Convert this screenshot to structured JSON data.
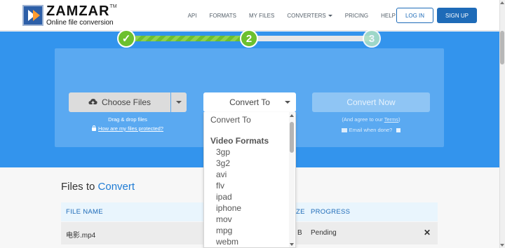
{
  "header": {
    "brand": "ZAMZAR",
    "brand_tm": "TM",
    "tagline": "Online file conversion",
    "nav": [
      "API",
      "FORMATS",
      "MY FILES",
      "CONVERTERS",
      "PRICING",
      "HELP"
    ],
    "login_label": "LOG IN",
    "signup_label": "SIGN UP"
  },
  "steps": {
    "step1_symbol": "✓",
    "step2_label": "2",
    "step3_label": "3",
    "progress_fraction": 0.5
  },
  "choose": {
    "button_label": "Choose Files",
    "drag_text": "Drag & drop files",
    "protect_link": "How are my files protected?"
  },
  "convert": {
    "select_value": "Convert To",
    "now_label": "Convert Now",
    "agree_prefix": "(And agree to our ",
    "agree_terms": "Terms",
    "agree_suffix": ")",
    "email_label": "Email when done?"
  },
  "dropdown": {
    "header": "Convert To",
    "group_label": "Video Formats",
    "options": [
      "3gp",
      "3g2",
      "avi",
      "flv",
      "ipad",
      "iphone",
      "mov",
      "mpg",
      "webm"
    ]
  },
  "files": {
    "title_prefix": "Files to ",
    "title_highlight": "Convert",
    "columns": {
      "name": "FILE NAME",
      "size_partial": "ZE",
      "progress": "PROGRESS"
    },
    "rows": [
      {
        "name": "电影.mp4",
        "size_partial": "B",
        "status": "Pending"
      }
    ],
    "close_symbol": "✕"
  },
  "colors": {
    "brand_blue": "#1e6bb8",
    "hero_blue": "#3394ed",
    "step_green": "#6cc02e"
  }
}
